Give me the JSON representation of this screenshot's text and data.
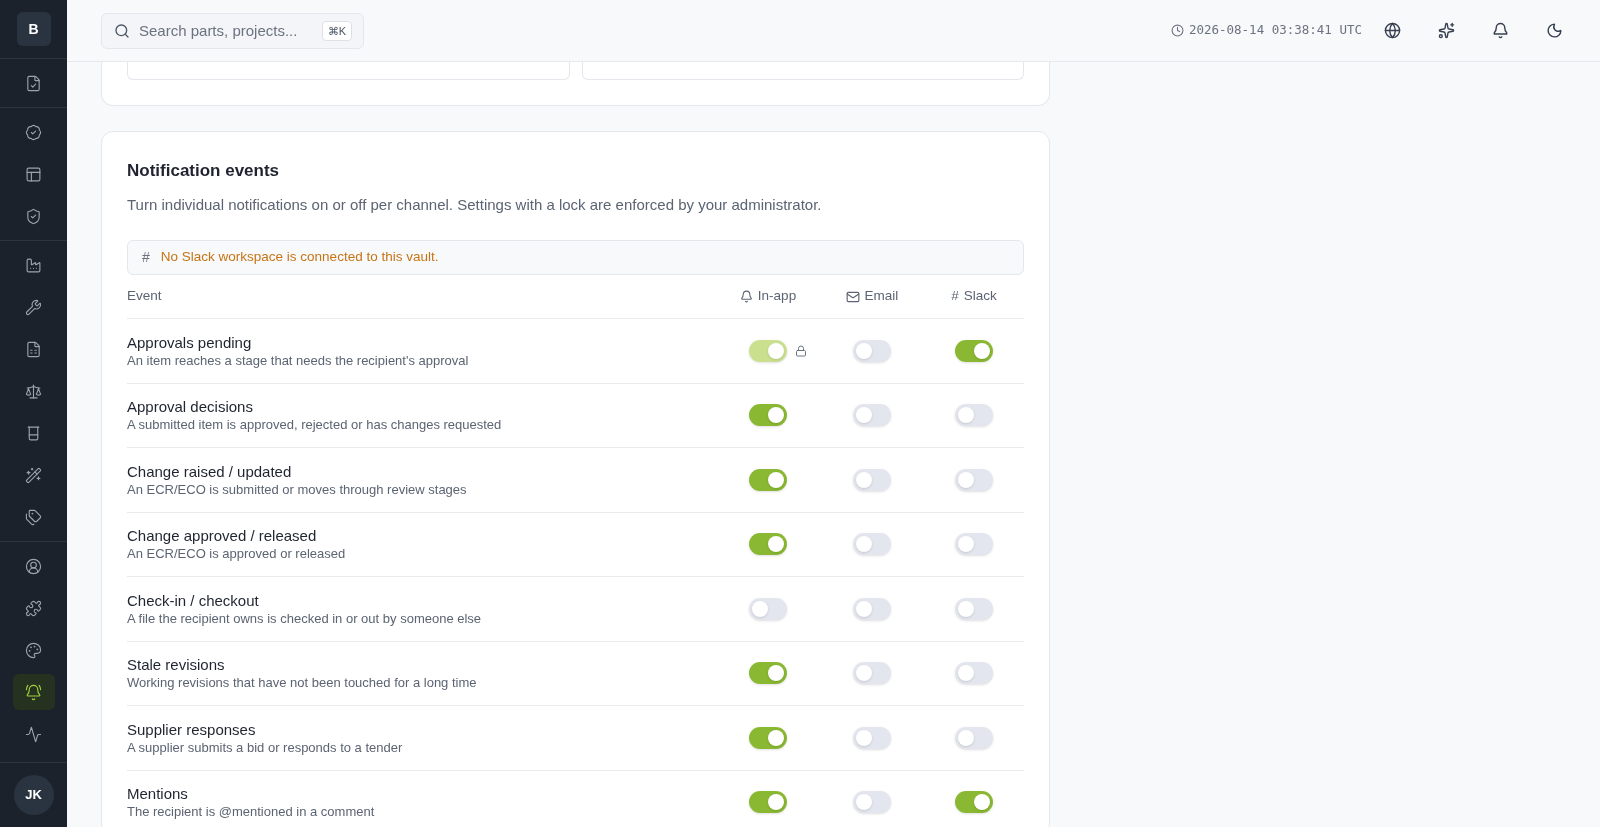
{
  "sidebar": {
    "logo": "B",
    "groups": [
      [
        {
          "selected": false
        }
      ],
      [
        {
          "selected": false
        },
        {
          "selected": false
        },
        {
          "selected": false
        }
      ],
      [
        {
          "selected": false
        },
        {
          "selected": false
        },
        {
          "selected": false
        },
        {
          "selected": false
        },
        {
          "selected": false
        },
        {
          "selected": false
        },
        {
          "selected": false
        }
      ],
      [
        {
          "selected": false
        },
        {
          "selected": false
        },
        {
          "selected": false
        },
        {
          "selected": true
        },
        {
          "selected": false
        }
      ]
    ],
    "avatar": "JK"
  },
  "header": {
    "search": {
      "placeholder": "Search parts, projects...",
      "shortcut": "⌘K"
    },
    "timestamp": "2026-08-14 03:38:41 UTC"
  },
  "section": {
    "title": "Notification events",
    "description": "Turn individual notifications on or off per channel. Settings with a lock are enforced by your administrator.",
    "notice": "No Slack workspace is connected to this vault.",
    "notice_icon": "#",
    "columns": {
      "event": "Event",
      "in_app": "In-app",
      "email": "Email",
      "slack": "Slack",
      "slack_icon": "#"
    },
    "rows": [
      {
        "title": "Approvals pending",
        "description": "An item reaches a stage that needs the recipient's approval",
        "in_app": {
          "on": true,
          "locked": true
        },
        "email": {
          "on": false
        },
        "slack": {
          "on": true
        }
      },
      {
        "title": "Approval decisions",
        "description": "A submitted item is approved, rejected or has changes requested",
        "in_app": {
          "on": true,
          "locked": false
        },
        "email": {
          "on": false
        },
        "slack": {
          "on": false
        }
      },
      {
        "title": "Change raised / updated",
        "description": "An ECR/ECO is submitted or moves through review stages",
        "in_app": {
          "on": true,
          "locked": false
        },
        "email": {
          "on": false
        },
        "slack": {
          "on": false
        }
      },
      {
        "title": "Change approved / released",
        "description": "An ECR/ECO is approved or released",
        "in_app": {
          "on": true,
          "locked": false
        },
        "email": {
          "on": false
        },
        "slack": {
          "on": false
        }
      },
      {
        "title": "Check-in / checkout",
        "description": "A file the recipient owns is checked in or out by someone else",
        "in_app": {
          "on": false,
          "locked": false
        },
        "email": {
          "on": false
        },
        "slack": {
          "on": false
        }
      },
      {
        "title": "Stale revisions",
        "description": "Working revisions that have not been touched for a long time",
        "in_app": {
          "on": true,
          "locked": false
        },
        "email": {
          "on": false
        },
        "slack": {
          "on": false
        }
      },
      {
        "title": "Supplier responses",
        "description": "A supplier submits a bid or responds to a tender",
        "in_app": {
          "on": true,
          "locked": false
        },
        "email": {
          "on": false
        },
        "slack": {
          "on": false
        }
      },
      {
        "title": "Mentions",
        "description": "The recipient is @mentioned in a comment",
        "in_app": {
          "on": true,
          "locked": false
        },
        "email": {
          "on": false
        },
        "slack": {
          "on": true
        }
      }
    ]
  }
}
